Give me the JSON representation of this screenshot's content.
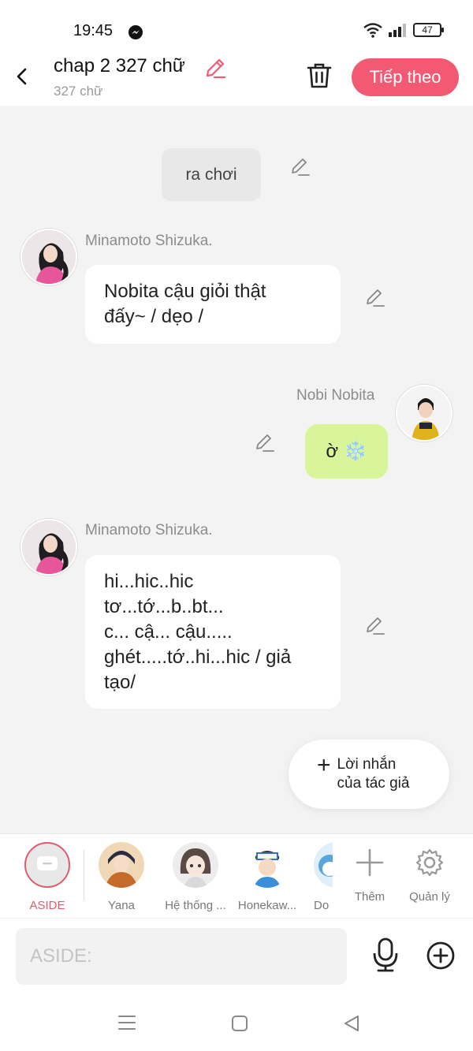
{
  "status_bar": {
    "time": "19:45",
    "battery": "47"
  },
  "header": {
    "title": "chap 2 327 chữ",
    "subtitle": "327 chữ",
    "next_label": "Tiếp theo"
  },
  "messages": [
    {
      "type": "narration",
      "text": "ra chơi"
    },
    {
      "type": "left",
      "speaker": "Minamoto Shizuka.",
      "text_lines": [
        "Nobita cậu giỏi thật",
        "đấy~ / dẹo /"
      ]
    },
    {
      "type": "right",
      "speaker": "Nobi Nobita",
      "text": "ờ ❄️"
    },
    {
      "type": "left",
      "speaker": "Minamoto Shizuka.",
      "text_lines": [
        "hi...hic..hic",
        "tơ...tớ...b..bt...",
        "c... cậ... cậu.....",
        "ghét.....tớ..hi...hic / giả",
        "tạo/"
      ]
    }
  ],
  "author_note": {
    "line1": "Lời nhắn",
    "line2": "của tác giả"
  },
  "characters": [
    {
      "name": "ASIDE",
      "active": true
    },
    {
      "name": "Yana"
    },
    {
      "name": "Hệ thống ..."
    },
    {
      "name": "Honekaw..."
    },
    {
      "name": "Do"
    },
    {
      "name": "Thêm"
    },
    {
      "name": "Quản lý"
    }
  ],
  "input": {
    "placeholder": "ASIDE:"
  },
  "colors": {
    "accent": "#f25a74",
    "green_bubble": "#d9f59a",
    "aside_ring": "#e05a6e"
  }
}
